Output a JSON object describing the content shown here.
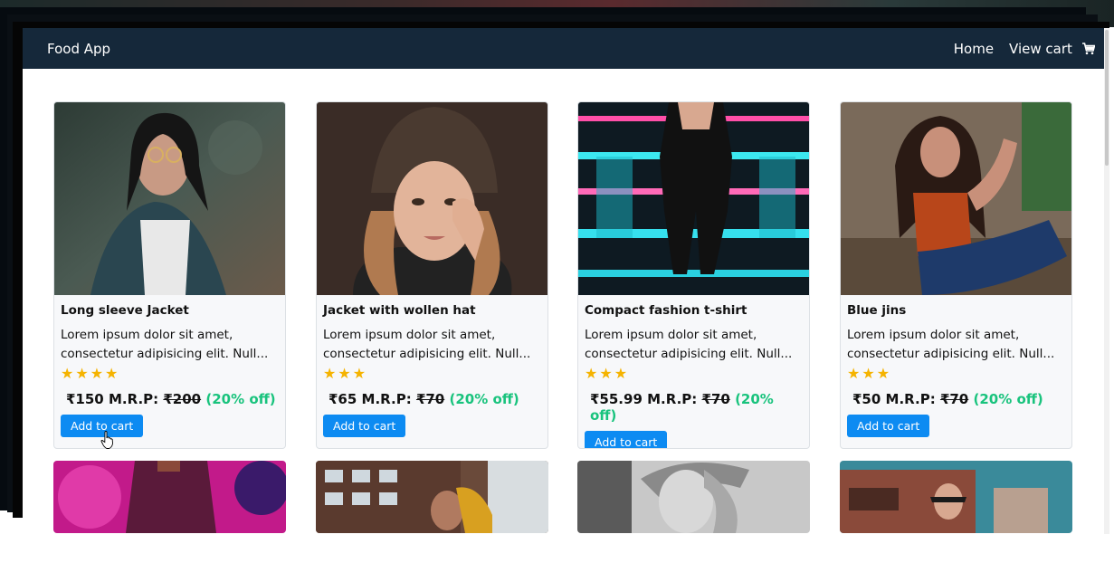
{
  "navbar": {
    "brand": "Food App",
    "links": [
      "Home",
      "View cart"
    ],
    "cart_icon": "cart-icon"
  },
  "products": [
    {
      "title": "Long sleeve Jacket",
      "description": "Lorem ipsum dolor sit amet, consectetur adipisicing elit. Null...",
      "rating": 4,
      "price": "₹150",
      "mrp_label": "M.R.P:",
      "mrp": "₹200",
      "discount": "(20% off)",
      "button": "Add to cart"
    },
    {
      "title": "Jacket with wollen hat",
      "description": "Lorem ipsum dolor sit amet, consectetur adipisicing elit. Null...",
      "rating": 3,
      "price": "₹65",
      "mrp_label": "M.R.P:",
      "mrp": "₹70",
      "discount": "(20% off)",
      "button": "Add to cart"
    },
    {
      "title": "Compact fashion t-shirt",
      "description": "Lorem ipsum dolor sit amet, consectetur adipisicing elit. Null...",
      "rating": 3,
      "price": "₹55.99",
      "mrp_label": "M.R.P:",
      "mrp": "₹70",
      "discount": "(20% off)",
      "button": "Add to cart"
    },
    {
      "title": "Blue jins",
      "description": "Lorem ipsum dolor sit amet, consectetur adipisicing elit. Null...",
      "rating": 3,
      "price": "₹50",
      "mrp_label": "M.R.P:",
      "mrp": "₹70",
      "discount": "(20% off)",
      "button": "Add to cart"
    }
  ],
  "colors": {
    "navbar": "#15283a",
    "button": "#0d8bf2",
    "star": "#f5b300",
    "discount": "#19c37d"
  }
}
